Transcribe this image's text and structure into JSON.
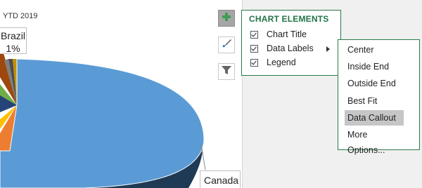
{
  "chart": {
    "title": "YTD 2019",
    "brazil_label": "Brazil",
    "brazil_value": "1%",
    "canada_label": "Canada"
  },
  "colors": {
    "canada": "#5b9bd5",
    "canada_dark": "#1f3a55",
    "panel_border": "#2b7a4b",
    "panel_title": "#217346"
  },
  "side_buttons": [
    {
      "name": "chart-elements-button",
      "icon": "plus-icon"
    },
    {
      "name": "chart-styles-button",
      "icon": "paintbrush-icon"
    },
    {
      "name": "chart-filters-button",
      "icon": "funnel-icon"
    }
  ],
  "chart_elements_panel": {
    "title": "CHART ELEMENTS",
    "items": [
      {
        "label": "Chart Title",
        "checked": true
      },
      {
        "label": "Data Labels",
        "checked": true,
        "has_submenu": true
      },
      {
        "label": "Legend",
        "checked": true
      }
    ]
  },
  "data_labels_submenu": {
    "items": [
      {
        "label": "Center"
      },
      {
        "label": "Inside End"
      },
      {
        "label": "Outside End"
      },
      {
        "label": "Best Fit"
      },
      {
        "label": "Data Callout",
        "highlighted": true
      },
      {
        "label": "More Options..."
      }
    ]
  }
}
